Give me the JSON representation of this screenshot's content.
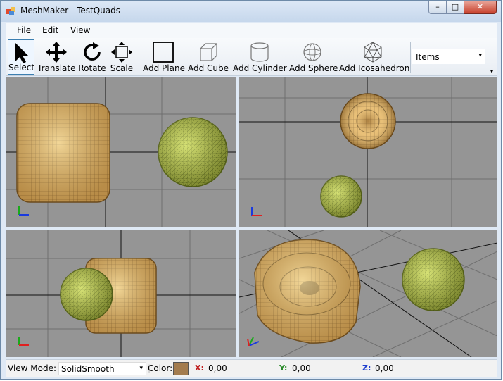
{
  "window": {
    "title": "MeshMaker - TestQuads",
    "minimize": "–",
    "maximize": "□",
    "close": "✕"
  },
  "menu": [
    "File",
    "Edit",
    "View"
  ],
  "toolbar": {
    "tools": [
      {
        "label": "Select",
        "icon": "arrow-cursor-icon",
        "selected": true
      },
      {
        "label": "Translate",
        "icon": "move-arrows-icon"
      },
      {
        "label": "Rotate",
        "icon": "rotate-icon"
      },
      {
        "label": "Scale",
        "icon": "scale-icon"
      },
      {
        "label": "Add Plane",
        "icon": "plane-icon"
      },
      {
        "label": "Add Cube",
        "icon": "cube-icon"
      },
      {
        "label": "Add Cylinder",
        "icon": "cylinder-icon"
      },
      {
        "label": "Add Sphere",
        "icon": "sphere-icon"
      },
      {
        "label": "Add Icosahedron",
        "icon": "icosahedron-icon"
      }
    ],
    "items_combo": "Items",
    "dropdown_arrow": "▾",
    "overflow_arrow": "▾"
  },
  "viewports": [
    {
      "name": "front",
      "objects": [
        "rounded-cube-quads",
        "sphere"
      ]
    },
    {
      "name": "top",
      "objects": [
        "rounded-cube-quads",
        "sphere"
      ]
    },
    {
      "name": "side",
      "objects": [
        "rounded-cube-quads",
        "sphere"
      ]
    },
    {
      "name": "perspective",
      "objects": [
        "rounded-cube-quads",
        "sphere"
      ]
    }
  ],
  "colors": {
    "mesh_tan": "#e2b061",
    "mesh_green": "#b9c44e",
    "viewport_bg": "#959595",
    "swatch": "#a37c4f"
  },
  "statusbar": {
    "view_mode_label": "View Mode:",
    "view_mode_value": "SolidSmooth",
    "color_label": "Color:",
    "x_label": "X:",
    "x_value": "0,00",
    "y_label": "Y:",
    "y_value": "0,00",
    "z_label": "Z:",
    "z_value": "0,00"
  }
}
